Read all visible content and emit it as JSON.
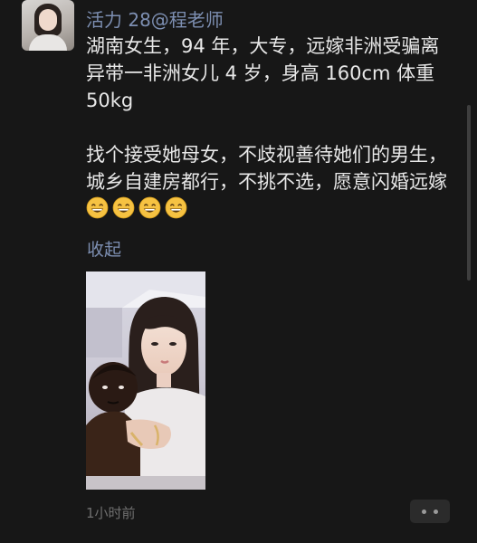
{
  "post": {
    "author": "活力 28@程老师",
    "paragraph1": "湖南女生，94 年，大专，远嫁非洲受骗离异带一非洲女儿 4 岁，身高 160cm 体重 50kg",
    "paragraph2": "找个接受她母女，不歧视善待她们的男生，城乡自建房都行，不挑不选，愿意闪婚远嫁",
    "emoji_count": 4,
    "emoji_icon": "grinning-face-icon",
    "collapse_label": "收起",
    "timestamp": "1小时前",
    "more_icon": "more-dots-icon"
  },
  "colors": {
    "background": "#171717",
    "link": "#7d8fb2",
    "text": "#e8e8e8",
    "muted": "#6f6f6f"
  }
}
